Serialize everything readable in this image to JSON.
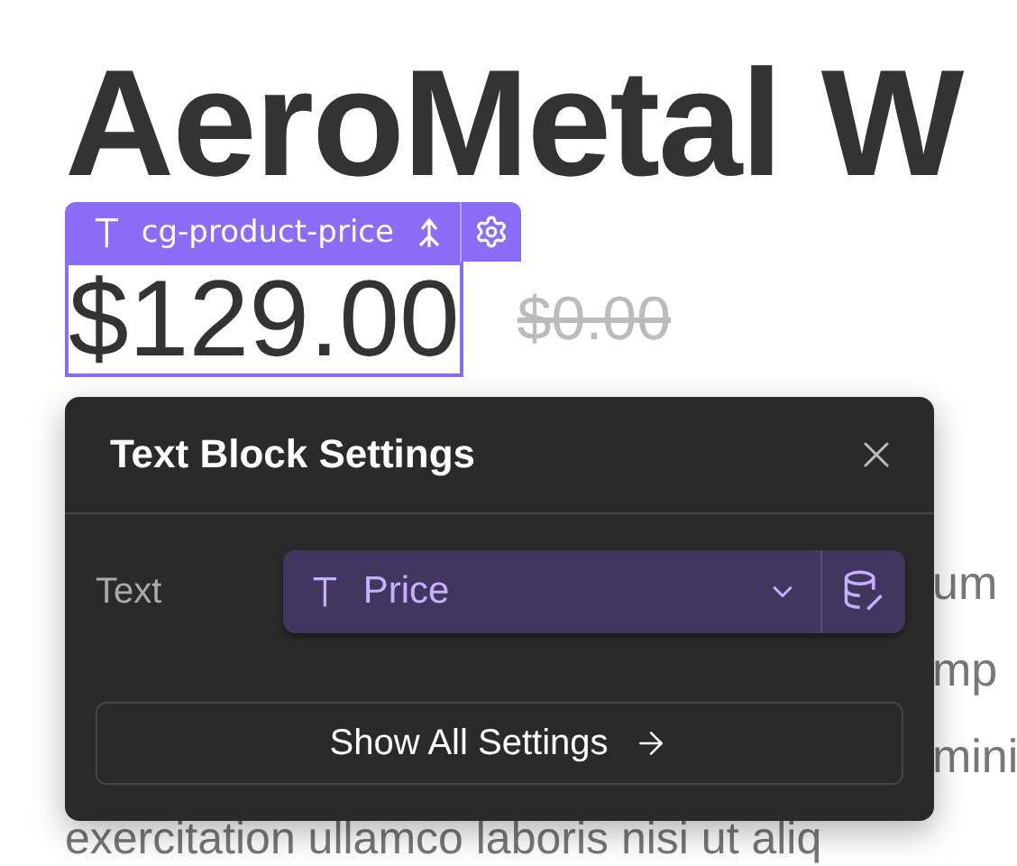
{
  "heading": "AeroMetal W",
  "element_tag": {
    "label": "cg-product-price"
  },
  "price": {
    "current": "$129.00",
    "original": "$0.00"
  },
  "settings_panel": {
    "title": "Text Block Settings",
    "fields": [
      {
        "label": "Text",
        "value": "Price"
      }
    ],
    "button": "Show All Settings"
  },
  "body_fragments": [
    "um",
    "mp",
    "mini"
  ],
  "body_last_line": "exercitation ullamco laboris nisi ut aliq"
}
